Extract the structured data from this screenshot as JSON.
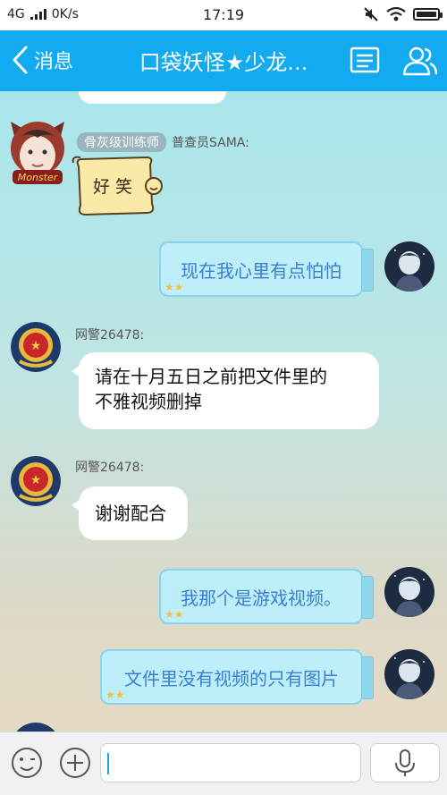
{
  "status_bar": {
    "network": "4G",
    "speed": "0K/s",
    "time": "17:19"
  },
  "nav": {
    "back_label": "消息",
    "title": "口袋妖怪★少龙..."
  },
  "messages": [
    {
      "sender_badge": "骨灰级训练师",
      "sender_name": "普查员SAMA:",
      "sticker_text": "好笑"
    },
    {
      "text": "现在我心里有点怕怕"
    },
    {
      "sender_name": "网警26478:",
      "line1": "请在十月五日之前把文件里的",
      "line2": "不雅视频删掉"
    },
    {
      "sender_name": "网警26478:",
      "text": "谢谢配合"
    },
    {
      "text": "我那个是游戏视频。"
    },
    {
      "text": "文件里没有视频的只有图片"
    }
  ],
  "avatar_monster_label": "Monster",
  "colors": {
    "nav": "#12aaf0",
    "bubble_right": "#bfeefb",
    "bubble_right_text": "#3a7fd0"
  }
}
